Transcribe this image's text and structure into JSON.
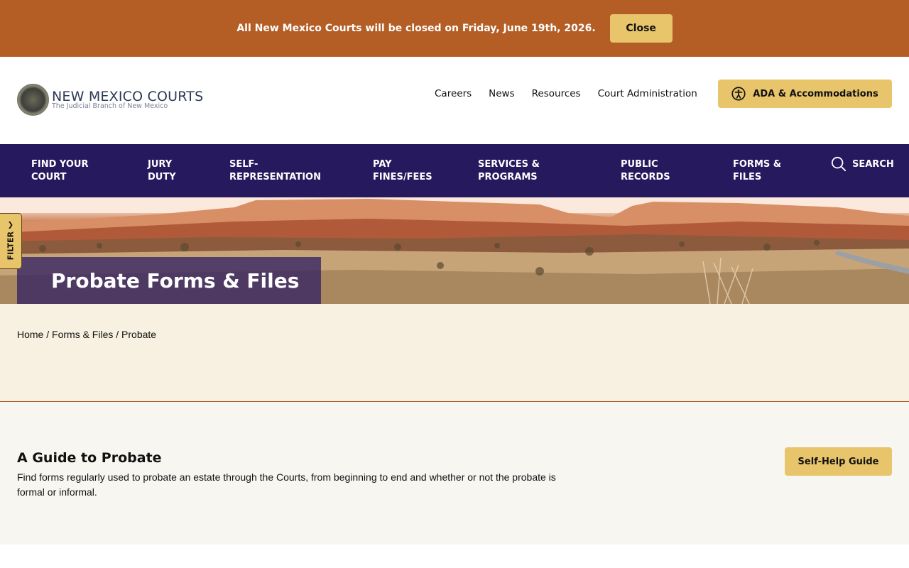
{
  "alert": {
    "message": "All New Mexico Courts will be closed on Friday, June 19th, 2026.",
    "close_label": "Close"
  },
  "header": {
    "logo_title": "NEW MEXICO COURTS",
    "logo_subtitle": "The Judicial Branch of New Mexico",
    "utility_links": [
      "Careers",
      "News",
      "Resources",
      "Court Administration"
    ],
    "ada_label": "ADA & Accommodations"
  },
  "nav": {
    "items": [
      {
        "line1": "FIND YOUR",
        "line2": "COURT"
      },
      {
        "line1": "JURY",
        "line2": "DUTY"
      },
      {
        "line1": "SELF-",
        "line2": "REPRESENTATION"
      },
      {
        "line1": "PAY",
        "line2": "FINES/FEES"
      },
      {
        "line1": "SERVICES &",
        "line2": "PROGRAMS"
      },
      {
        "line1": "PUBLIC",
        "line2": "RECORDS"
      },
      {
        "line1": "FORMS &",
        "line2": "FILES"
      }
    ],
    "search_label": "SEARCH"
  },
  "filter": {
    "label": "FILTER"
  },
  "hero": {
    "title": "Probate Forms & Files"
  },
  "breadcrumb": {
    "items": [
      "Home",
      "Forms & Files",
      "Probate"
    ],
    "separator": "/"
  },
  "guide": {
    "title": "A Guide to Probate",
    "description": "Find forms regularly used to probate an estate through the Courts, from beginning to end and whether or not the probate is formal or informal.",
    "button_label": "Self-Help Guide"
  },
  "colors": {
    "alert_bg": "#b45e26",
    "accent_gold": "#e8c46a",
    "nav_bg": "#27195e",
    "crumb_bg": "#f8f0e0"
  }
}
